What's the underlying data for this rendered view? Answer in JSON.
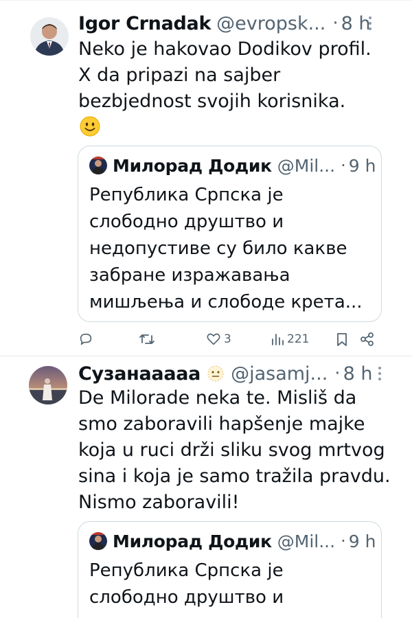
{
  "tweets": [
    {
      "name": "Igor Crnadak",
      "handle": "@evropsk...",
      "dot": "·",
      "time": "8 h",
      "text": [
        "Neko je hakovao Dodikov profil.",
        "X da pripazi na sajber",
        "bezbjednost svojih korisnika."
      ],
      "emoji": "slightly-smiling-face-icon",
      "quote": {
        "name": "Милорад Додик",
        "handle": "@Mil...",
        "dot": "·",
        "time": "9 h",
        "text": [
          "Република Српска је",
          "слободно друштво и",
          "недопустиве су било какве",
          "забране изражавања",
          "мишљења и слободе крета..."
        ]
      },
      "actions": {
        "replies": "",
        "reposts": "",
        "likes": "3",
        "views": "221"
      }
    },
    {
      "name": "Сузанааааа",
      "handle": "@jasamj...",
      "dot": "·",
      "time": "8 h",
      "text": [
        "De Milorade neka te. Misliš da",
        "smo zaboravili hapšenje majke",
        "koja u ruci drži sliku svog mrtvog",
        "sina i koja je samo tražila pravdu.",
        "Nismo zaboravili!"
      ],
      "quote": {
        "name": "Милорад Додик",
        "handle": "@Mil...",
        "dot": "·",
        "time": "9 h",
        "text": [
          "Република Српска је",
          "слободно друштво и"
        ]
      }
    }
  ],
  "colors": {
    "text": "#0f1419",
    "secondary": "#536471",
    "border": "#cfd9de",
    "smiley": "#ffcc33"
  }
}
